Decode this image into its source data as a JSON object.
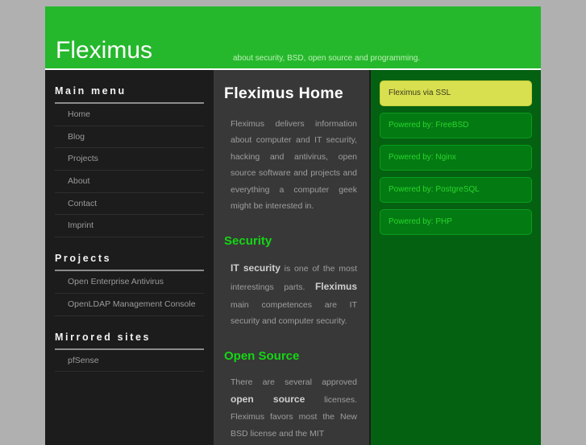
{
  "header": {
    "title": "Fleximus",
    "tagline": "about security, BSD, open source and programming."
  },
  "sidebar": {
    "blocks": [
      {
        "heading": "Main menu",
        "items": [
          {
            "label": "Home"
          },
          {
            "label": "Blog"
          },
          {
            "label": "Projects"
          },
          {
            "label": "About"
          },
          {
            "label": "Contact"
          },
          {
            "label": "Imprint"
          }
        ]
      },
      {
        "heading": "Projects",
        "items": [
          {
            "label": "Open Enterprise Antivirus"
          },
          {
            "label": "OpenLDAP Management Console"
          }
        ]
      },
      {
        "heading": "Mirrored sites",
        "items": [
          {
            "label": "pfSense"
          }
        ]
      }
    ]
  },
  "main": {
    "title": "Fleximus Home",
    "intro": "Fleximus delivers information about computer and IT security, hacking and antivirus, open source software and projects and everything a computer geek might be interested in.",
    "sections": [
      {
        "heading": "Security",
        "lead": "IT security",
        "body_after_lead": " is one of the most interestings parts. ",
        "lead2": "Fleximus",
        "body_after_lead2": " main competences are IT security and computer security."
      },
      {
        "heading": "Open Source",
        "body_before_lead": "There are several approved ",
        "lead": "open source",
        "body_after_lead": " licenses. Fleximus favors most the New BSD license and the MIT"
      }
    ]
  },
  "right_sidebar": {
    "badges": [
      {
        "label": "Fleximus via SSL",
        "style": "ssl"
      },
      {
        "label": "Powered by: FreeBSD",
        "style": "green"
      },
      {
        "label": "Powered by: Nginx",
        "style": "green"
      },
      {
        "label": "Powered by: PostgreSQL",
        "style": "green"
      },
      {
        "label": "Powered by: PHP",
        "style": "green"
      }
    ]
  },
  "colors": {
    "header_green": "#25b82c",
    "accent_green": "#14d614",
    "sidebar_dark": "#1c1c1c",
    "content_dark": "#383838",
    "right_green": "#046111",
    "ssl_yellow": "#d9e04f",
    "page_background": "#b0b0b0"
  }
}
